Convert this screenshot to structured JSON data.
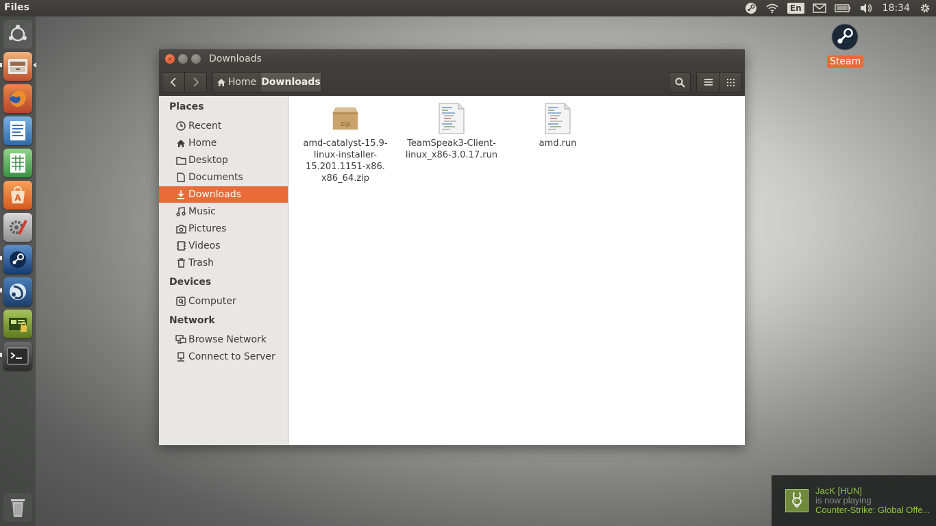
{
  "top_panel": {
    "app_name": "Files",
    "lang": "En",
    "clock": "18:34"
  },
  "launcher": {
    "items": [
      "dash",
      "files",
      "firefox",
      "writer",
      "calc",
      "software-center",
      "system-settings",
      "steam",
      "teamspeak",
      "hardware-driver",
      "terminal",
      "trash"
    ]
  },
  "desktop": {
    "steam_label": "Steam"
  },
  "window": {
    "title": "Downloads",
    "breadcrumb": {
      "home": "Home",
      "current": "Downloads"
    }
  },
  "sidebar": {
    "places_heading": "Places",
    "places": [
      {
        "label": "Recent",
        "icon": "clock-icon"
      },
      {
        "label": "Home",
        "icon": "home-icon"
      },
      {
        "label": "Desktop",
        "icon": "folder-icon"
      },
      {
        "label": "Documents",
        "icon": "document-icon"
      },
      {
        "label": "Downloads",
        "icon": "download-icon"
      },
      {
        "label": "Music",
        "icon": "music-icon"
      },
      {
        "label": "Pictures",
        "icon": "camera-icon"
      },
      {
        "label": "Videos",
        "icon": "film-icon"
      },
      {
        "label": "Trash",
        "icon": "trash-icon"
      }
    ],
    "devices_heading": "Devices",
    "devices": [
      {
        "label": "Computer",
        "icon": "drive-icon"
      }
    ],
    "network_heading": "Network",
    "network": [
      {
        "label": "Browse Network",
        "icon": "network-icon"
      },
      {
        "label": "Connect to Server",
        "icon": "server-icon"
      }
    ]
  },
  "files": [
    {
      "name": "amd-catalyst-15.9-linux-installer-15.201.1151-x86.x86_64.zip",
      "lines": [
        "amd-catalyst-15.9-",
        "linux-installer-",
        "15.201.1151-x86.",
        "x86_64.zip"
      ],
      "icon": "zip-archive-icon",
      "badge": "zip"
    },
    {
      "name": "TeamSpeak3-Client-linux_x86-3.0.17.run",
      "lines": [
        "TeamSpeak3-Client-",
        "linux_x86-3.0.17.run"
      ],
      "icon": "script-file-icon"
    },
    {
      "name": "amd.run",
      "lines": [
        "amd.run"
      ],
      "icon": "script-file-icon"
    }
  ],
  "notification": {
    "name": "JacK [HUN]",
    "status": "is now playing",
    "game": "Counter-Strike: Global Offe..."
  },
  "colors": {
    "accent": "#e96b3a",
    "panel": "#3c3b37",
    "steam_green": "#8cc63e"
  }
}
